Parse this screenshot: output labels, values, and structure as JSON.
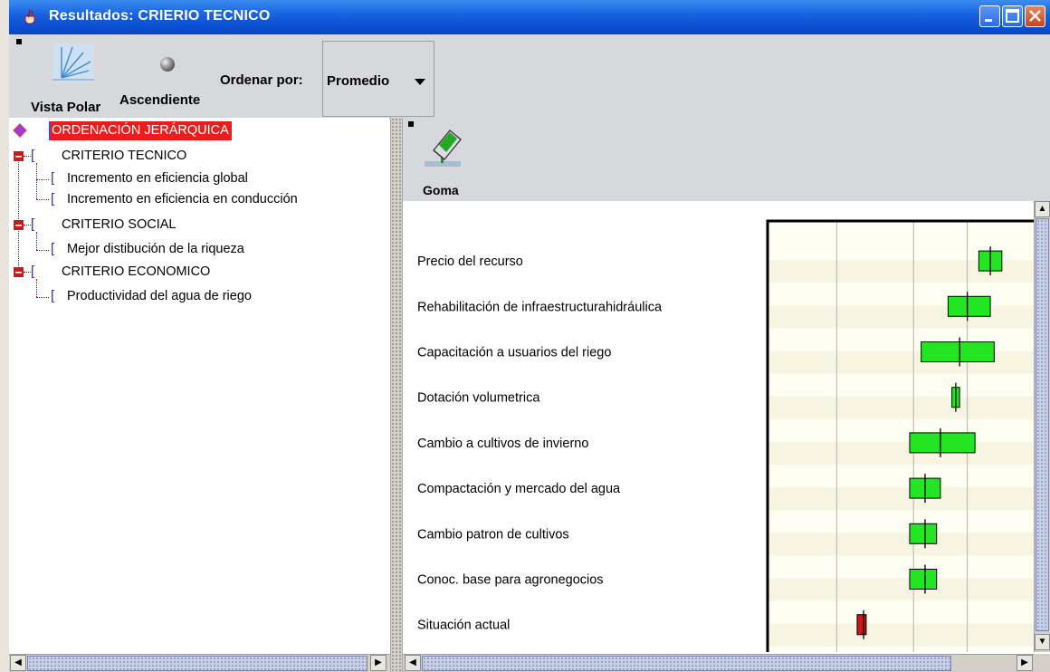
{
  "window": {
    "title": "Resultados: CRIERIO TECNICO"
  },
  "toolbar": {
    "polar_label": "Vista Polar",
    "ascending_label": "Ascendiente",
    "sort_label": "Ordenar por:",
    "sort_value": "Promedio"
  },
  "right_toolbar": {
    "eraser_label": "Goma"
  },
  "tree": {
    "root": "ORDENACIÓN JERÁRQUICA",
    "groups": [
      {
        "label": "CRITERIO TECNICO",
        "children": [
          "Incremento en eficiencia global",
          "Incremento en eficiencia en conducción"
        ]
      },
      {
        "label": "CRITERIO SOCIAL",
        "children": [
          "Mejor distibución de la riqueza"
        ]
      },
      {
        "label": "CRITERIO ECONOMICO",
        "children": [
          "Productividad del agua de riego"
        ]
      }
    ]
  },
  "chart_data": {
    "type": "box",
    "orientation": "horizontal",
    "xlim": [
      0,
      1
    ],
    "grid": true,
    "categories": [
      "Precio del recurso",
      "Rehabilitación de infraestructurahidráulica",
      "Capacitación a usuarios del riego",
      "Dotación volumetrica",
      "Cambio a cultivos de invierno",
      "Compactación y mercado del agua",
      "Cambio patron de cultivos",
      "Conoc. base para agronegocios",
      "Situación actual"
    ],
    "low": [
      0.97,
      0.89,
      0.82,
      0.9,
      0.79,
      0.79,
      0.79,
      0.79,
      0.66
    ],
    "mean": [
      1.0,
      0.94,
      0.92,
      0.91,
      0.87,
      0.83,
      0.83,
      0.83,
      0.67
    ],
    "high": [
      1.03,
      1.0,
      1.01,
      0.92,
      0.96,
      0.87,
      0.86,
      0.86,
      0.67
    ],
    "colors": [
      "#22e622",
      "#22e622",
      "#22e622",
      "#22e622",
      "#22e622",
      "#22e622",
      "#22e622",
      "#22e622",
      "#d01818"
    ]
  }
}
